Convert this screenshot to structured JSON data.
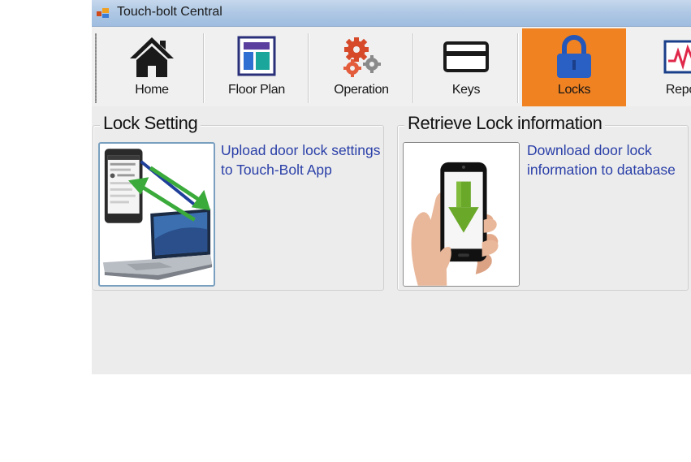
{
  "window": {
    "title": "Touch-bolt Central"
  },
  "toolbar": {
    "items": [
      {
        "label": "Home",
        "icon": "home-icon"
      },
      {
        "label": "Floor Plan",
        "icon": "floor-plan-icon"
      },
      {
        "label": "Operation",
        "icon": "gears-icon"
      },
      {
        "label": "Keys",
        "icon": "card-icon"
      },
      {
        "label": "Locks",
        "icon": "padlock-icon"
      },
      {
        "label": "Report",
        "icon": "report-chart-icon"
      }
    ],
    "active": "Locks"
  },
  "lock_setting": {
    "title": "Lock Setting",
    "description": "Upload door lock settings to Touch-Bolt App",
    "icon": "phone-laptop-sync-icon"
  },
  "retrieve_lock": {
    "title": "Retrieve Lock information",
    "description": "Download door lock information to database",
    "icon": "phone-download-icon"
  },
  "colors": {
    "active_tab": "#f08222",
    "link_text": "#2a3fa8",
    "titlebar": "#aec7e4"
  }
}
